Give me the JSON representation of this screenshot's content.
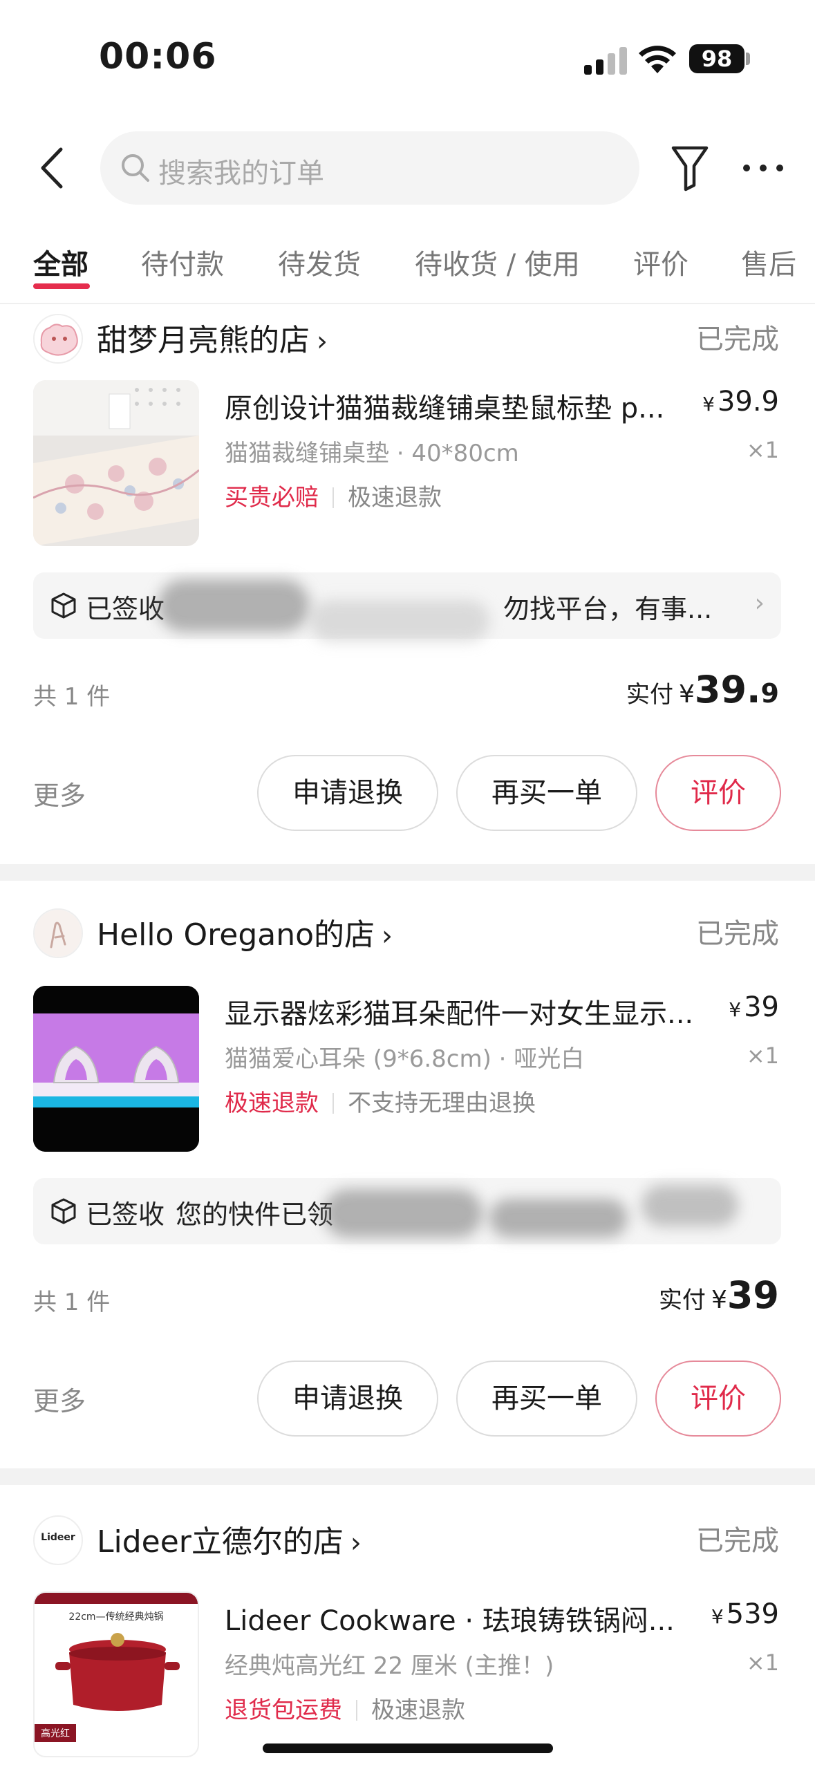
{
  "status_bar": {
    "time": "00:06",
    "battery": "98"
  },
  "search": {
    "placeholder": "搜索我的订单"
  },
  "tabs": [
    {
      "label": "全部",
      "active": true
    },
    {
      "label": "待付款"
    },
    {
      "label": "待发货"
    },
    {
      "label": "待收货 / 使用"
    },
    {
      "label": "评价"
    },
    {
      "label": "售后"
    }
  ],
  "orders": [
    {
      "shop": "甜梦月亮熊的店",
      "status": "已完成",
      "title": "原创设计猫猫裁缝铺桌垫鼠标垫 p...",
      "price_currency": "¥",
      "price": "39.9",
      "spec": "猫猫裁缝铺桌垫 · 40*80cm",
      "qty": "×1",
      "tag_red": "买贵必赔",
      "tag_grey": "极速退款",
      "logistics_status": "已签收",
      "logistics_text": "勿找平台，有事...",
      "count": "共 1 件",
      "paid_label": "实付",
      "paid_currency": "¥",
      "paid_int": "39.",
      "paid_dec": "9",
      "more": "更多",
      "btn_refund": "申请退换",
      "btn_rebuy": "再买一单",
      "btn_review": "评价"
    },
    {
      "shop": "Hello Oregano的店",
      "status": "已完成",
      "title": "显示器炫彩猫耳朵配件一对女生显示...",
      "price_currency": "¥",
      "price": "39",
      "spec": "猫猫爱心耳朵 (9*6.8cm) · 哑光白",
      "qty": "×1",
      "tag_red": "极速退款",
      "tag_grey": "不支持无理由退换",
      "logistics_status": "已签收",
      "logistics_text": "您的快件已领",
      "count": "共 1 件",
      "paid_label": "实付",
      "paid_currency": "¥",
      "paid_int": "39",
      "paid_dec": "",
      "more": "更多",
      "btn_refund": "申请退换",
      "btn_rebuy": "再买一单",
      "btn_review": "评价"
    },
    {
      "shop": "Lideer立德尔的店",
      "logo_text": "Lideer",
      "status": "已完成",
      "title": "Lideer Cookware · 珐琅铸铁锅闷...",
      "price_currency": "¥",
      "price": "539",
      "spec": "经典炖高光红 22 厘米 (主推！)",
      "qty": "×1",
      "tag_red": "退货包运费",
      "tag_grey": "极速退款",
      "thumb_caption": "22cm—传统经典炖锅",
      "thumb_badge": "高光红"
    }
  ],
  "colors": {
    "accent": "#e02a4a",
    "divider": "#f2f2f2"
  }
}
